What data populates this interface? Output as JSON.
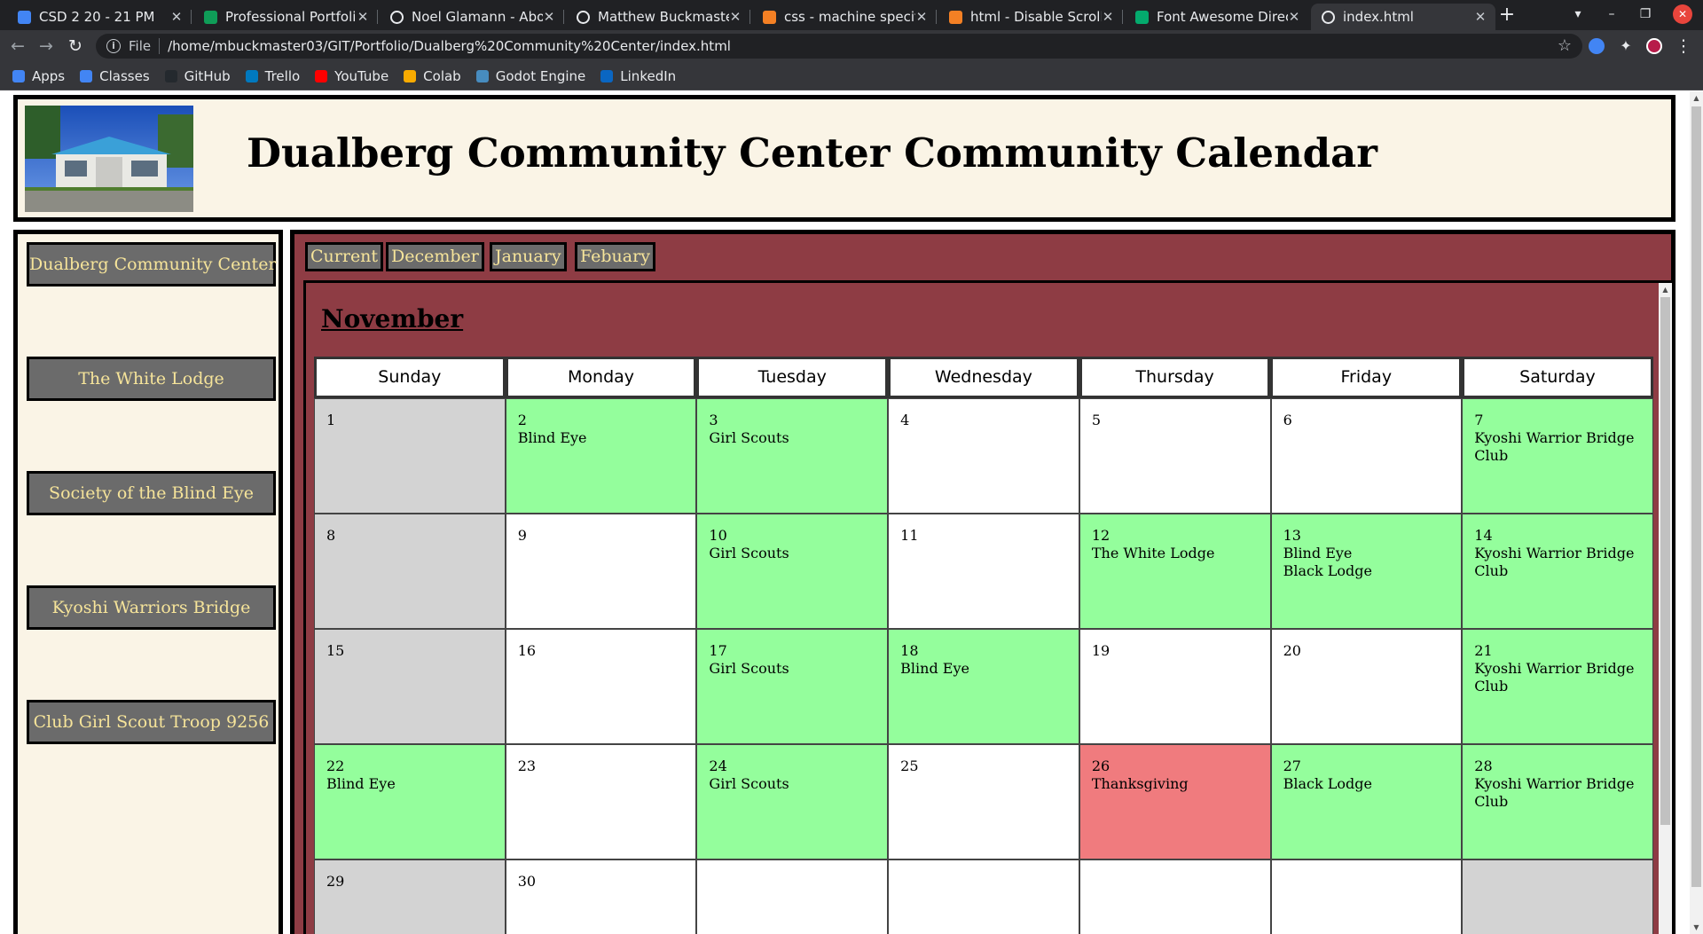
{
  "browser": {
    "tabs": [
      {
        "title": "CSD 2 20 - 21 PM",
        "icon": "classroom-icon",
        "color": "#4285f4"
      },
      {
        "title": "Professional Portfoli",
        "icon": "sheets-icon",
        "color": "#0f9d58"
      },
      {
        "title": "Noel Glamann - Abou",
        "icon": "globe-icon",
        "color": "#e8eaed"
      },
      {
        "title": "Matthew Buckmaster",
        "icon": "globe-icon",
        "color": "#e8eaed"
      },
      {
        "title": "css - machine specific",
        "icon": "stackoverflow-icon",
        "color": "#f48024"
      },
      {
        "title": "html - Disable Scrollin",
        "icon": "stackoverflow-icon",
        "color": "#f48024"
      },
      {
        "title": "Font Awesome Direc",
        "icon": "w3-icon",
        "color": "#04aa6d"
      },
      {
        "title": "index.html",
        "icon": "globe-icon",
        "color": "#e8eaed"
      }
    ],
    "active_tab": 7,
    "new_tab": "+",
    "address": {
      "scheme_label": "File",
      "url": "/home/mbuckmaster03/GIT/Portfolio/Dualberg%20Community%20Center/index.html"
    },
    "bookmarks": [
      {
        "label": "Apps",
        "icon": "apps-grid-icon",
        "color": "#4285f4"
      },
      {
        "label": "Classes",
        "icon": "classroom-icon",
        "color": "#4285f4"
      },
      {
        "label": "GitHub",
        "icon": "github-icon",
        "color": "#24292e"
      },
      {
        "label": "Trello",
        "icon": "trello-icon",
        "color": "#0079bf"
      },
      {
        "label": "YouTube",
        "icon": "youtube-icon",
        "color": "#ff0000"
      },
      {
        "label": "Colab",
        "icon": "colab-icon",
        "color": "#f9ab00"
      },
      {
        "label": "Godot Engine",
        "icon": "godot-icon",
        "color": "#478cbf"
      },
      {
        "label": "LinkedIn",
        "icon": "linkedin-icon",
        "color": "#0a66c2"
      }
    ]
  },
  "page": {
    "title": "Dualberg Community Center Community Calendar",
    "sidebar": [
      "Dualberg Community Center",
      "The White Lodge",
      "Society of the Blind Eye",
      "Kyoshi Warriors Bridge",
      "Club Girl Scout Troop 9256"
    ],
    "month_tabs": [
      "Current",
      "December",
      "January",
      "Febuary"
    ],
    "month_title": "November",
    "weekdays": [
      "Sunday",
      "Monday",
      "Tuesday",
      "Wednesday",
      "Thursday",
      "Friday",
      "Saturday"
    ],
    "days": [
      {
        "text": "1",
        "style": "grey"
      },
      {
        "text": "2\nBlind Eye",
        "style": "green"
      },
      {
        "text": "3\nGirl Scouts",
        "style": "green"
      },
      {
        "text": "4",
        "style": "white"
      },
      {
        "text": "5",
        "style": "white"
      },
      {
        "text": "6",
        "style": "white"
      },
      {
        "text": "7\nKyoshi Warrior Bridge Club",
        "style": "green"
      },
      {
        "text": "8",
        "style": "grey"
      },
      {
        "text": "9",
        "style": "white"
      },
      {
        "text": "10\nGirl Scouts",
        "style": "green"
      },
      {
        "text": "11",
        "style": "white"
      },
      {
        "text": "12\nThe White Lodge",
        "style": "green"
      },
      {
        "text": "13\nBlind Eye\nBlack Lodge",
        "style": "green"
      },
      {
        "text": "14\nKyoshi Warrior Bridge Club",
        "style": "green"
      },
      {
        "text": "15",
        "style": "grey"
      },
      {
        "text": "16",
        "style": "white"
      },
      {
        "text": "17\nGirl Scouts",
        "style": "green"
      },
      {
        "text": "18\nBlind Eye",
        "style": "green"
      },
      {
        "text": "19",
        "style": "white"
      },
      {
        "text": "20",
        "style": "white"
      },
      {
        "text": "21\nKyoshi Warrior Bridge Club",
        "style": "green"
      },
      {
        "text": "22\nBlind Eye",
        "style": "green"
      },
      {
        "text": "23",
        "style": "white"
      },
      {
        "text": "24\nGirl Scouts",
        "style": "green"
      },
      {
        "text": "25",
        "style": "white"
      },
      {
        "text": "26\nThanksgiving",
        "style": "red"
      },
      {
        "text": "27\nBlack Lodge",
        "style": "green"
      },
      {
        "text": "28\nKyoshi Warrior Bridge Club",
        "style": "green"
      },
      {
        "text": "29",
        "style": "grey"
      },
      {
        "text": "30",
        "style": "white"
      },
      {
        "text": "",
        "style": "white"
      },
      {
        "text": "",
        "style": "white"
      },
      {
        "text": "",
        "style": "white"
      },
      {
        "text": "",
        "style": "white"
      },
      {
        "text": "",
        "style": "grey"
      }
    ]
  }
}
